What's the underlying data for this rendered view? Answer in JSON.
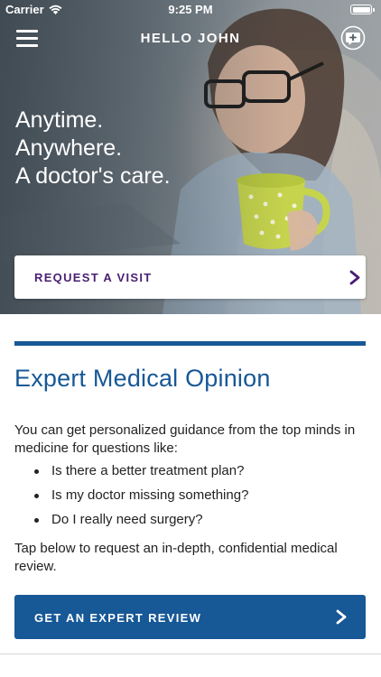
{
  "status_bar": {
    "carrier": "Carrier",
    "time": "9:25 PM",
    "icons": [
      "wifi-icon",
      "battery-icon"
    ]
  },
  "nav": {
    "title": "HELLO JOHN",
    "menu_icon": "hamburger-menu-icon",
    "action_icon": "chat-plus-icon"
  },
  "hero": {
    "headline": [
      "Anytime.",
      "Anywhere.",
      "A doctor's care."
    ],
    "request_button_label": "REQUEST A VISIT",
    "request_button_icon": "chevron-right-icon"
  },
  "content": {
    "title": "Expert Medical Opinion",
    "intro": "You can get personalized guidance from the top minds in medicine for questions like:",
    "bullets": [
      "Is there a better treatment plan?",
      "Is my doctor missing something?",
      "Do I really need surgery?"
    ],
    "outro": "Tap below to request an in-depth, confidential medical review.",
    "expert_button_label": "GET AN EXPERT REVIEW",
    "expert_button_icon": "chevron-right-icon"
  },
  "colors": {
    "brand_blue": "#175896",
    "purple_text": "#4a1f73",
    "body_text": "#222222",
    "white": "#ffffff"
  }
}
